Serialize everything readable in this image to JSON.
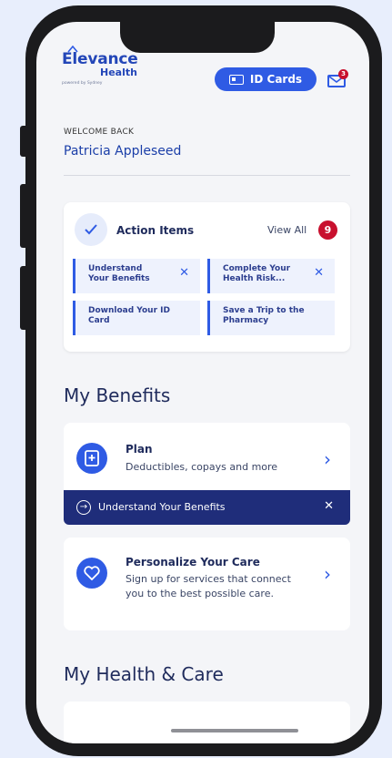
{
  "logo": {
    "brand_line1": "Elevance",
    "brand_line2": "Health",
    "powered_by": "powered by Sydney"
  },
  "header": {
    "id_cards_label": "ID Cards",
    "messages_badge": "3"
  },
  "greeting": {
    "welcome": "WELCOME BACK",
    "name": "Patricia Appleseed"
  },
  "action_items": {
    "title": "Action Items",
    "view_all": "View All",
    "count": "9",
    "tiles": [
      {
        "label": "Understand Your Benefits"
      },
      {
        "label": "Complete Your Health Risk..."
      },
      {
        "label": "Download Your ID Card"
      },
      {
        "label": "Save a Trip to the Pharmacy"
      }
    ]
  },
  "benefits": {
    "heading": "My Benefits",
    "plan": {
      "title": "Plan",
      "subtitle": "Deductibles, copays and more"
    },
    "banner": {
      "label": "Understand Your Benefits"
    },
    "care": {
      "title": "Personalize Your Care",
      "subtitle": "Sign up for services that connect you to the best possible care."
    }
  },
  "health": {
    "heading": "My Health & Care"
  },
  "colors": {
    "accent": "#2f5be4",
    "banner": "#1f2d7a",
    "badge": "#c8102e",
    "background": "#e8eefc"
  }
}
